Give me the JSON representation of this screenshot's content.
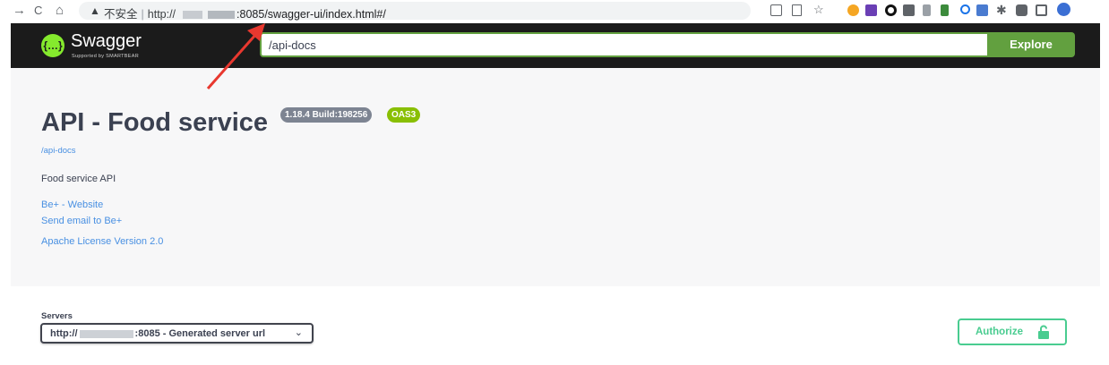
{
  "browser": {
    "back_glyph": "→",
    "reload_glyph": "C",
    "home_glyph": "⌂",
    "warning_glyph": "▲",
    "insecure_label": "不安全",
    "url_prefix": "http://",
    "url_suffix": ":8085/swagger-ui/index.html#/"
  },
  "header": {
    "logo_symbol": "{…}",
    "logo_text": "Swagger",
    "logo_subtext": "Supported by SMARTBEAR",
    "search_value": "/api-docs",
    "explore_label": "Explore"
  },
  "info": {
    "title": "API - Food service",
    "version_badge": "1.18.4 Build:198256",
    "oas_badge": "OAS3",
    "url_link": "/api-docs",
    "description": "Food service API",
    "links": [
      "Be+ - Website",
      "Send email to Be+",
      "Apache License Version 2.0"
    ]
  },
  "servers": {
    "label": "Servers",
    "selected_prefix": "http://",
    "selected_suffix": ":8085 - Generated server url",
    "chevron": "⌄"
  },
  "authorize": {
    "label": "Authorize"
  },
  "colors": {
    "topbar": "#1b1b1b",
    "swagger_green": "#62a03f",
    "authorize_green": "#49cc90",
    "link_blue": "#4990e2",
    "annotation_red": "#e8382f"
  }
}
